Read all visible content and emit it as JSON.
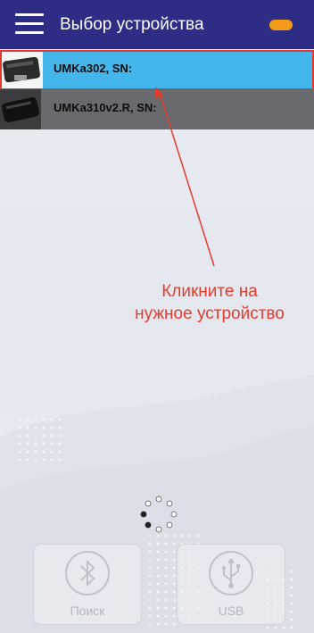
{
  "header": {
    "title": "Выбор устройства",
    "menu_icon": "hamburger-menu-icon",
    "status_color": "#f39a17"
  },
  "devices": [
    {
      "label": "UMKa302, SN:",
      "selected": true,
      "icon": "tracker-device-icon"
    },
    {
      "label": "UMKa310v2.R, SN:",
      "selected": false,
      "icon": "tracker-device-icon"
    }
  ],
  "annotation": {
    "line1": "Кликните на",
    "line2": "нужное устройство",
    "color": "#e43c2d"
  },
  "actions": {
    "bluetooth": {
      "label": "Поиск",
      "icon": "bluetooth-icon"
    },
    "usb": {
      "label": "USB",
      "icon": "usb-icon"
    }
  },
  "colors": {
    "appbar": "#2e2d86",
    "selected_row": "#45b6ec",
    "row": "#696a6d",
    "highlight_border": "#e23b2e"
  }
}
